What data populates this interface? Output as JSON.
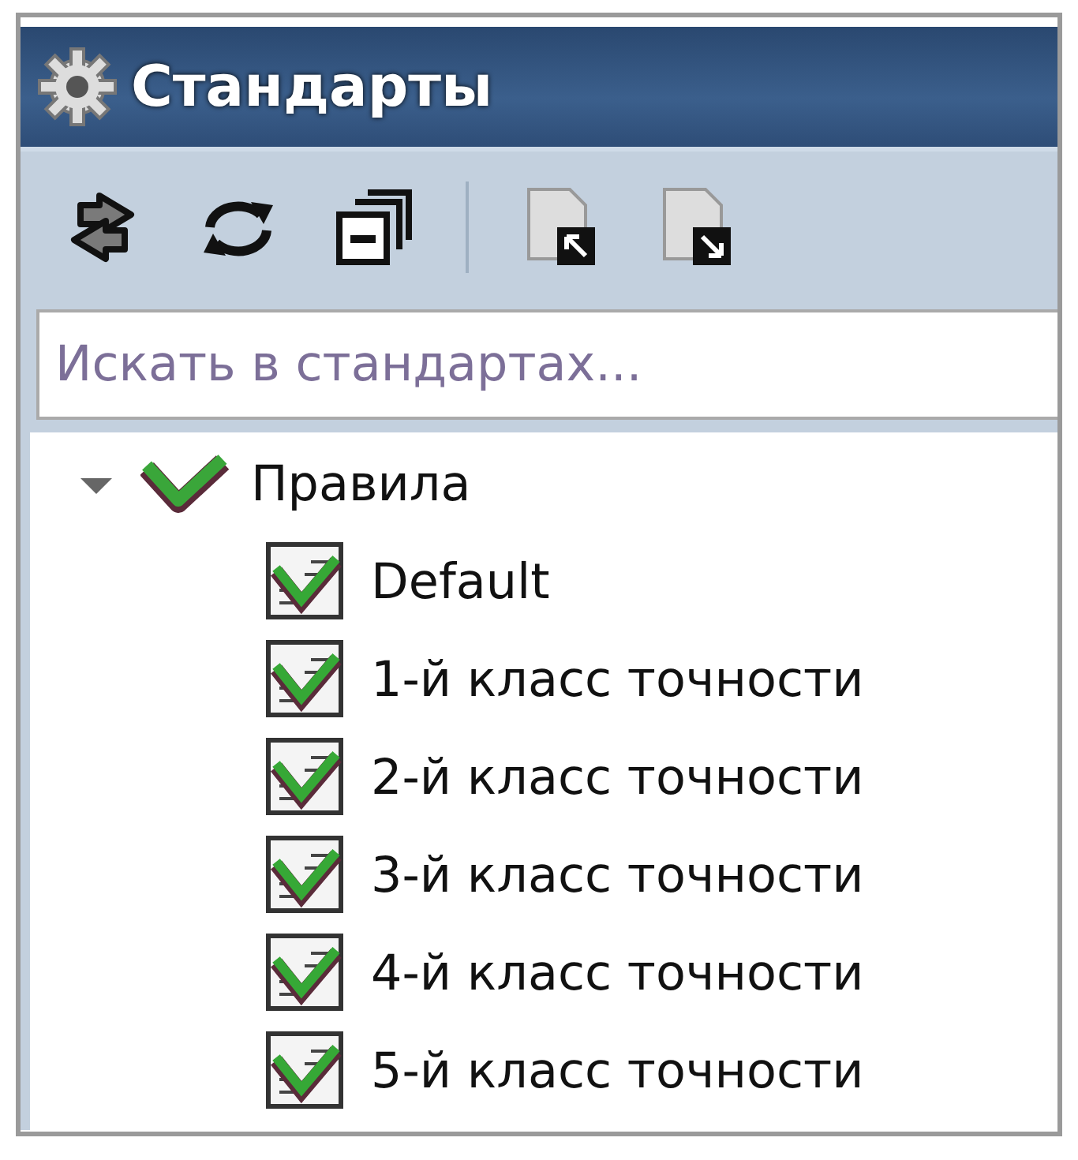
{
  "window": {
    "title": "Стандарты"
  },
  "toolbar": [
    {
      "kind": "swap"
    },
    {
      "kind": "refresh"
    },
    {
      "kind": "collapse"
    },
    {
      "kind": "separator"
    },
    {
      "kind": "import"
    },
    {
      "kind": "export"
    }
  ],
  "search": {
    "placeholder": "Искать в стандартах..."
  },
  "tree": [
    {
      "label": "Правила",
      "kind": "group",
      "expanded": true,
      "children": [
        {
          "label": "Default",
          "kind": "rule"
        },
        {
          "label": "1-й класс точности",
          "kind": "rule"
        },
        {
          "label": "2-й класс точности",
          "kind": "rule"
        },
        {
          "label": "3-й класс точности",
          "kind": "rule"
        },
        {
          "label": "4-й класс точности",
          "kind": "rule"
        },
        {
          "label": "5-й класс точности",
          "kind": "rule"
        }
      ]
    }
  ]
}
